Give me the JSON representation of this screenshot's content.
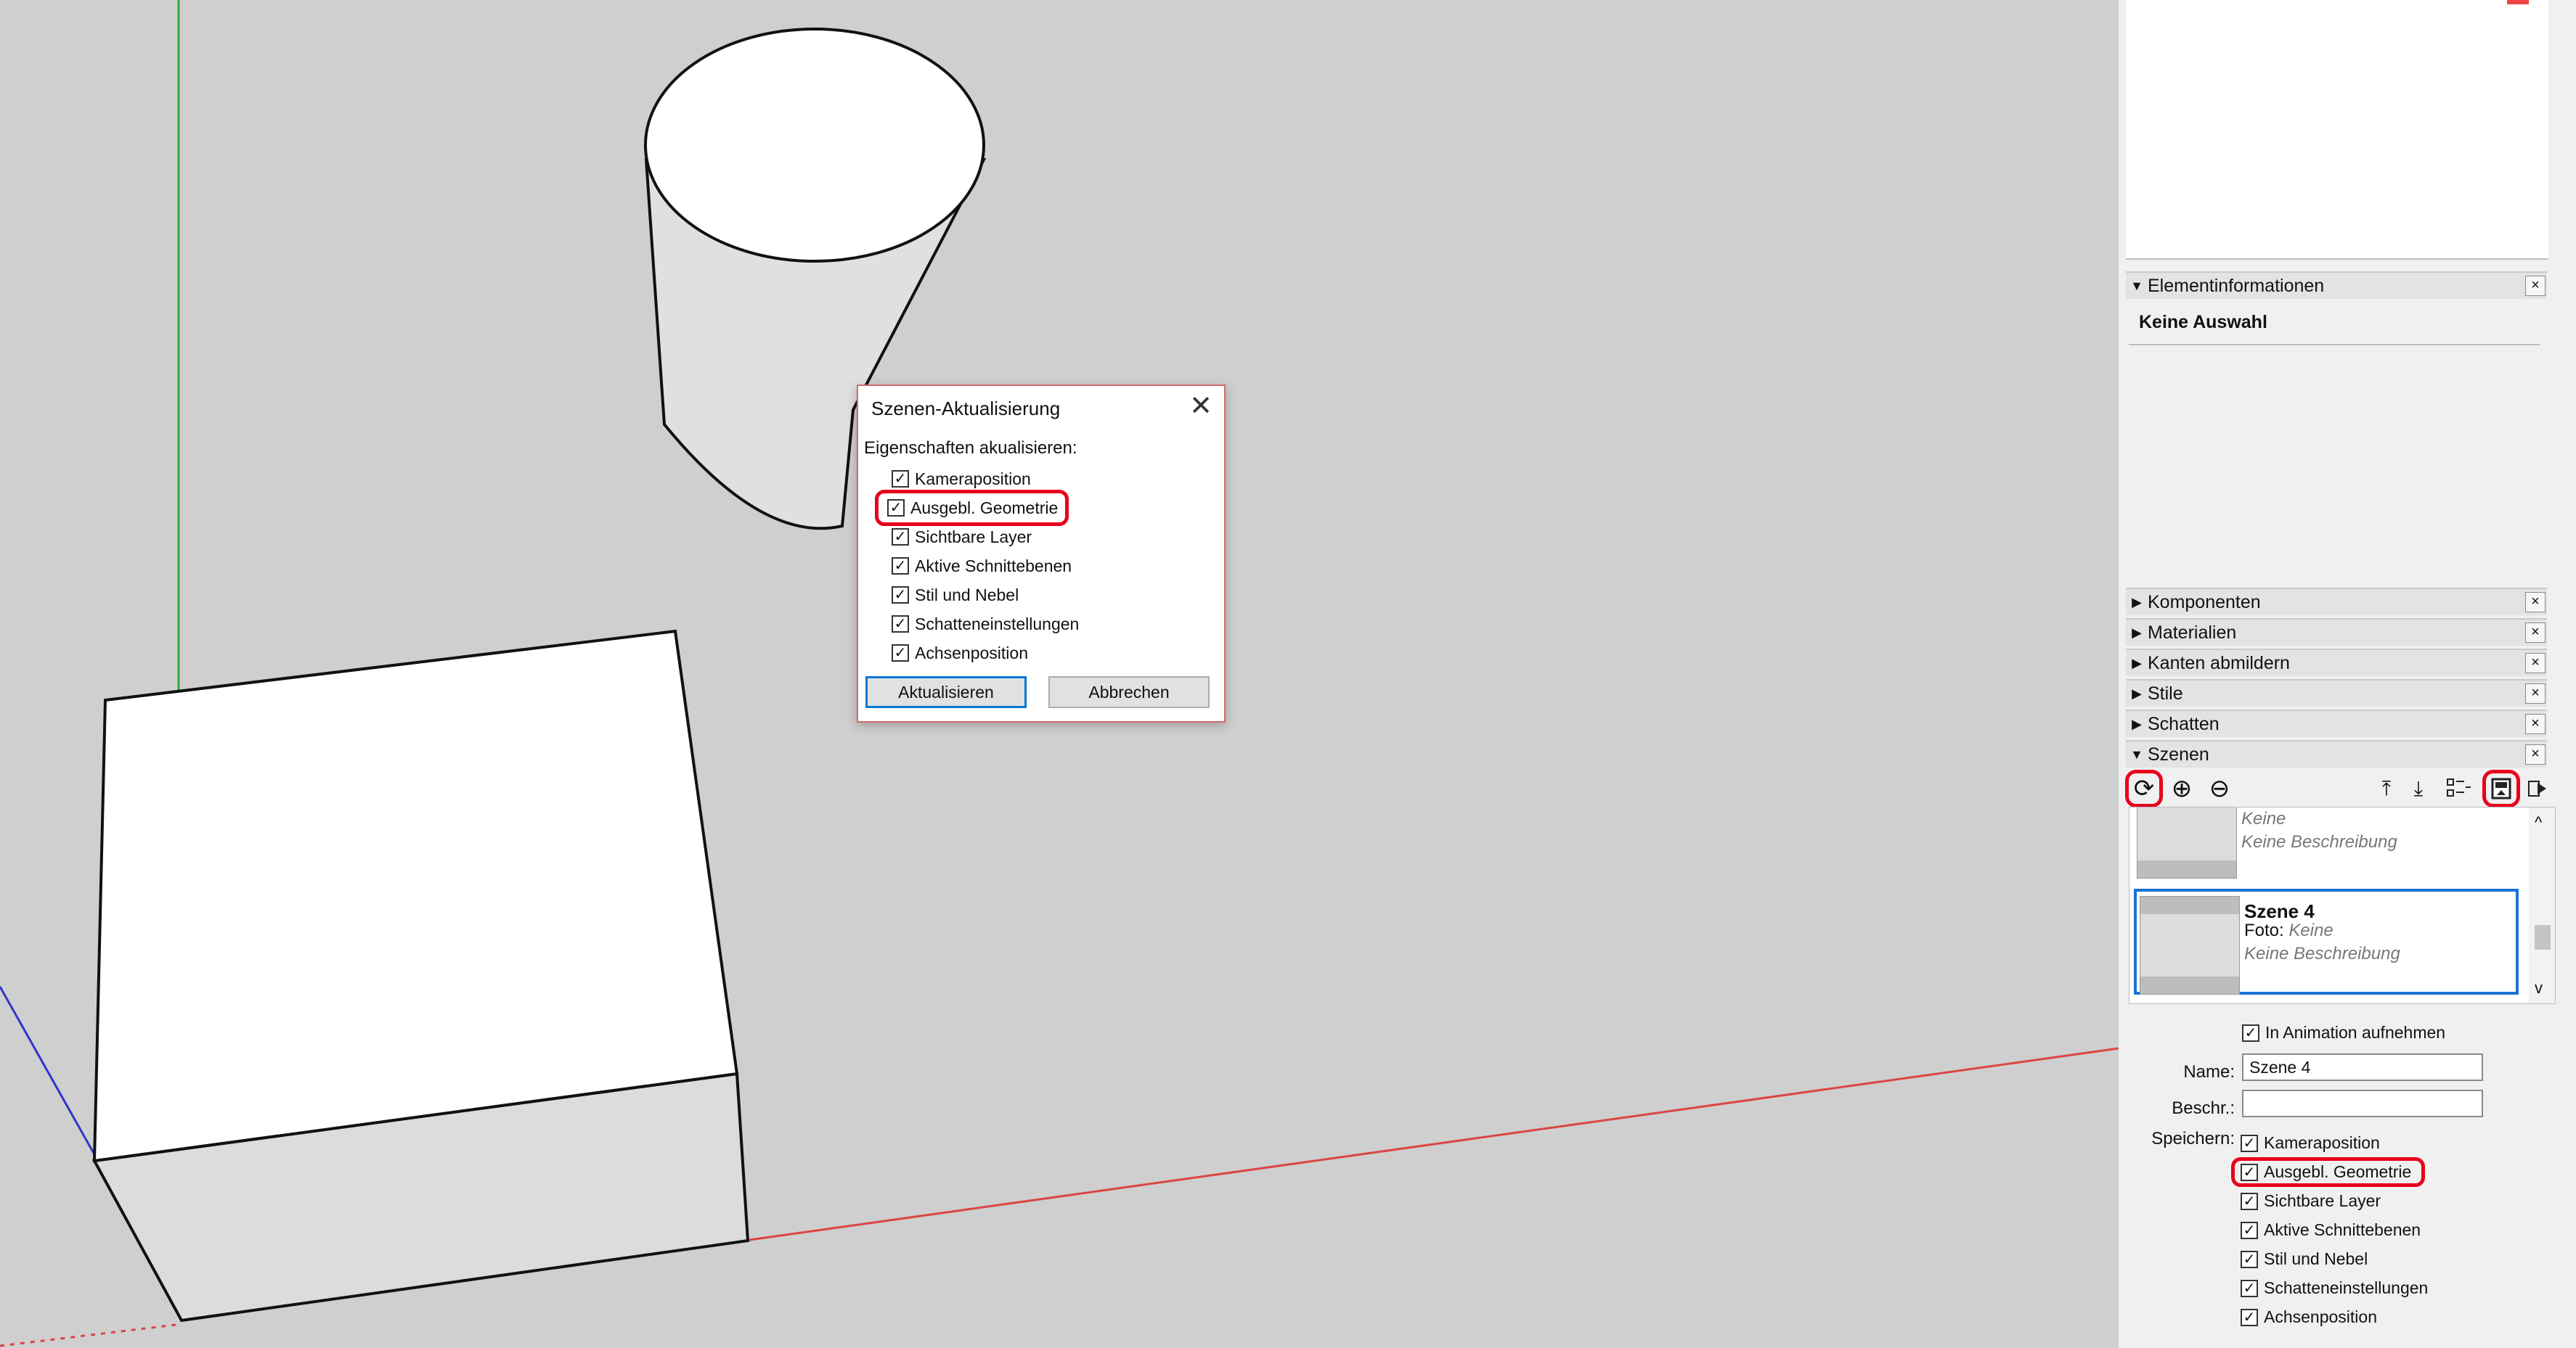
{
  "dialog": {
    "title": "Szenen-Aktualisierung",
    "close_glyph": "✕",
    "subtitle": "Eigenschaften akualisieren:",
    "options": [
      {
        "label": "Kameraposition",
        "checked": true
      },
      {
        "label": "Ausgebl. Geometrie",
        "checked": true,
        "highlighted": true
      },
      {
        "label": "Sichtbare Layer",
        "checked": true
      },
      {
        "label": "Aktive Schnittebenen",
        "checked": true
      },
      {
        "label": "Stil und Nebel",
        "checked": true
      },
      {
        "label": "Schatteneinstellungen",
        "checked": true
      },
      {
        "label": "Achsenposition",
        "checked": true
      }
    ],
    "update_label": "Aktualisieren",
    "cancel_label": "Abbrechen"
  },
  "tray": {
    "element_info_title": "Elementinformationen",
    "no_selection": "Keine Auswahl",
    "panels": [
      "Komponenten",
      "Materialien",
      "Kanten abmildern",
      "Stile",
      "Schatten",
      "Szenen"
    ],
    "scene_prev": {
      "foto_value": "Keine",
      "description": "Keine Beschreibung"
    },
    "scene_current": {
      "name": "Szene 4",
      "foto_label": "Foto:",
      "foto_value": "Keine",
      "description": "Keine Beschreibung"
    },
    "include_animation": "In Animation aufnehmen",
    "name_label": "Name:",
    "name_value": "Szene 4",
    "desc_label": "Beschr.:",
    "desc_value": "",
    "save_label": "Speichern:",
    "save_options": [
      {
        "label": "Kameraposition",
        "checked": true
      },
      {
        "label": "Ausgebl. Geometrie",
        "checked": true,
        "highlighted": true
      },
      {
        "label": "Sichtbare Layer",
        "checked": true
      },
      {
        "label": "Aktive Schnittebenen",
        "checked": true
      },
      {
        "label": "Stil und Nebel",
        "checked": true
      },
      {
        "label": "Schatteneinstellungen",
        "checked": true
      },
      {
        "label": "Achsenposition",
        "checked": true
      }
    ]
  },
  "glyphs": {
    "check": "✓",
    "close": "×",
    "tri_open": "▼",
    "tri_closed": "▶",
    "refresh": "⟳",
    "add": "⊕",
    "remove": "⊖",
    "move_up": "⤒",
    "move_down": "⤓",
    "up_arrow": "^",
    "down_arrow": "v"
  },
  "colors": {
    "highlight": "#e8001c",
    "selection": "#1a73d6",
    "axis_red": "#d44",
    "axis_green": "#3a3",
    "axis_blue": "#33c"
  }
}
